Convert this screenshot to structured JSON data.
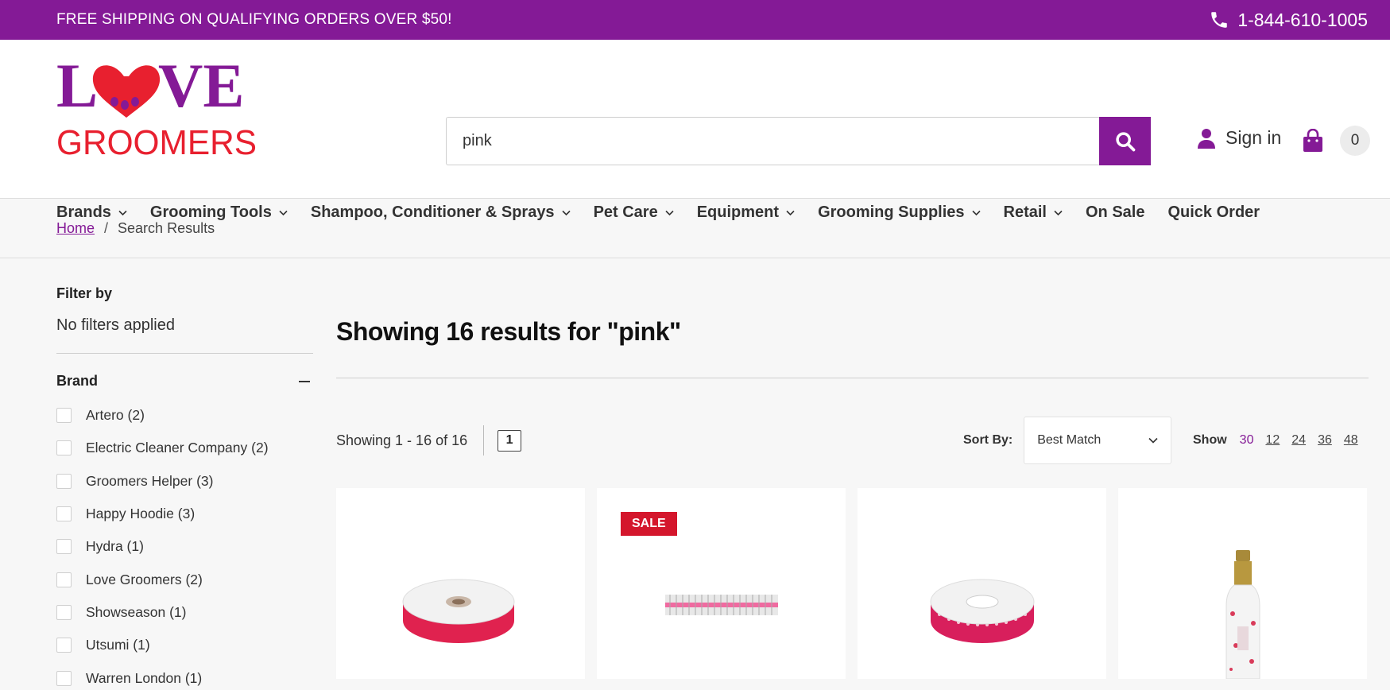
{
  "topbar": {
    "promo": "FREE SHIPPING ON QUALIFYING ORDERS OVER $50!",
    "phone": "1-844-610-1005"
  },
  "logo": {
    "line1": "LOVE",
    "line2": "GROOMERS",
    "colors": {
      "purple": "#841a96",
      "red": "#e8202f"
    }
  },
  "search": {
    "value": "pink"
  },
  "account": {
    "signin": "Sign in",
    "cart_count": "0"
  },
  "nav": {
    "items": [
      {
        "label": "Brands",
        "dropdown": true
      },
      {
        "label": "Grooming Tools",
        "dropdown": true
      },
      {
        "label": "Shampoo, Conditioner & Sprays",
        "dropdown": true
      },
      {
        "label": "Pet Care",
        "dropdown": true
      },
      {
        "label": "Equipment",
        "dropdown": true
      },
      {
        "label": "Grooming Supplies",
        "dropdown": true
      },
      {
        "label": "Retail",
        "dropdown": true
      },
      {
        "label": "On Sale",
        "dropdown": false
      },
      {
        "label": "Quick Order",
        "dropdown": false
      }
    ]
  },
  "breadcrumb": {
    "home": "Home",
    "current": "Search Results"
  },
  "filters": {
    "title": "Filter by",
    "none": "No filters applied",
    "brand_title": "Brand",
    "brands": [
      "Artero (2)",
      "Electric Cleaner Company (2)",
      "Groomers Helper (3)",
      "Happy Hoodie (3)",
      "Hydra (1)",
      "Love Groomers (2)",
      "Showseason (1)",
      "Utsumi (1)",
      "Warren London (1)"
    ]
  },
  "results": {
    "heading": "Showing 16 results for \"pink\"",
    "showing": "Showing 1 - 16 of 16",
    "page": "1",
    "sort_label": "Sort By:",
    "sort_value": "Best Match",
    "show_label": "Show",
    "show_options": [
      "30",
      "12",
      "24",
      "36",
      "48"
    ],
    "show_active": "30"
  },
  "products": [
    {
      "badge": "",
      "image": "pink-satin-ribbon-spool"
    },
    {
      "badge": "SALE",
      "image": "pink-comb"
    },
    {
      "badge": "",
      "image": "pink-polka-dot-ribbon-spool"
    },
    {
      "badge": "",
      "image": "spray-bottle"
    }
  ],
  "colors": {
    "brand": "#841a96",
    "sale": "#d4162c"
  }
}
